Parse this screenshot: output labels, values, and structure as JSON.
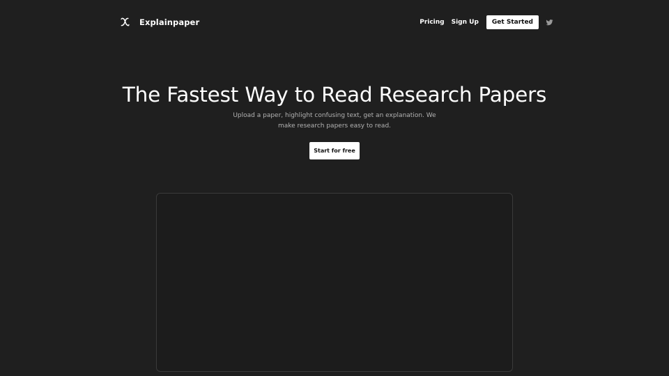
{
  "header": {
    "brand": "Explainpaper",
    "logo_icon": "explainpaper-x-logo-icon",
    "nav": {
      "pricing": "Pricing",
      "sign_up": "Sign Up",
      "get_started": "Get Started",
      "twitter_icon": "twitter-icon"
    }
  },
  "hero": {
    "title": "The Fastest Way to Read Research Papers",
    "subtitle": "Upload a paper, highlight confusing text, get an explanation. We make research papers easy to read.",
    "cta": "Start for free"
  },
  "colors": {
    "background": "#1f1f1f",
    "text": "#ffffff",
    "muted_text": "#b3b3b3",
    "button_bg": "#ffffff",
    "button_text": "#111111",
    "frame_border": "#3a3a3a"
  }
}
